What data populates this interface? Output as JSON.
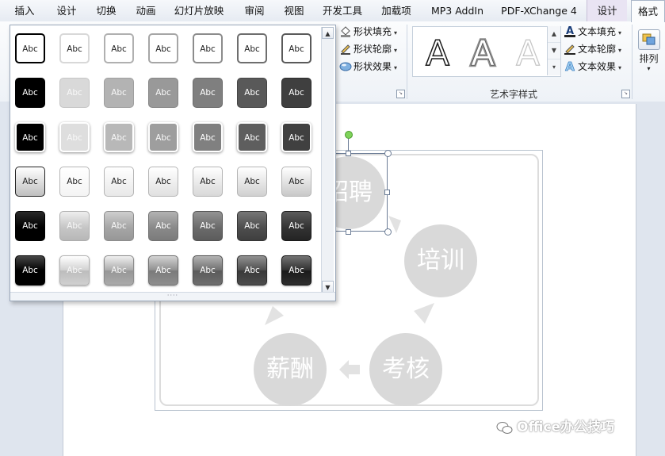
{
  "tabs": [
    {
      "label": "插入"
    },
    {
      "label": "设计"
    },
    {
      "label": "切换"
    },
    {
      "label": "动画"
    },
    {
      "label": "幻灯片放映"
    },
    {
      "label": "审阅"
    },
    {
      "label": "视图"
    },
    {
      "label": "开发工具"
    },
    {
      "label": "加载项"
    },
    {
      "label": "MP3 AddIn"
    },
    {
      "label": "PDF-XChange 4"
    },
    {
      "label": "设计"
    },
    {
      "label": "格式",
      "active": true
    }
  ],
  "ribbon": {
    "shape_fill": "形状填充",
    "shape_outline": "形状轮廓",
    "shape_effects": "形状效果",
    "text_fill": "文本填充",
    "text_outline": "文本轮廓",
    "text_effects": "文本效果",
    "wordart_group_label": "艺术字样式",
    "wordart_letter": "A",
    "arrange": "排列"
  },
  "style_gallery": {
    "swatch_text": "Abc",
    "rows": [
      {
        "kind": "outline",
        "shades": [
          "#000000",
          "#d8d8d8",
          "#b0b0b0",
          "#a6a6a6",
          "#8c8c8c",
          "#6e6e6e",
          "#5a5a5a"
        ]
      },
      {
        "kind": "fill",
        "shades": [
          "#000000",
          "#d9d9d9",
          "#b3b3b3",
          "#999999",
          "#7f7f7f",
          "#595959",
          "#3f3f3f"
        ]
      },
      {
        "kind": "fill-white-border",
        "shades": [
          "#000000",
          "#dedede",
          "#b8b8b8",
          "#9e9e9e",
          "#808080",
          "#5e5e5e",
          "#404040"
        ]
      },
      {
        "kind": "light-gradient",
        "shades": [
          "#bfbfbf",
          "#f4f4f4",
          "#e8e8e8",
          "#e0e0e0",
          "#d8d8d8",
          "#d0d0d0",
          "#c8c8c8"
        ]
      },
      {
        "kind": "gradient",
        "shades": [
          "#000000",
          "#c6c6c6",
          "#a6a6a6",
          "#8a8a8a",
          "#6b6b6b",
          "#4e4e4e",
          "#333333"
        ]
      },
      {
        "kind": "glossy",
        "shades": [
          "#000000",
          "#d0d0d0",
          "#aaaaaa",
          "#8e8e8e",
          "#6e6e6e",
          "#4c4c4c",
          "#2e2e2e"
        ]
      }
    ]
  },
  "smartart": {
    "nodes": [
      {
        "label": "招聘"
      },
      {
        "label": "培训"
      },
      {
        "label": "考核"
      },
      {
        "label": "薪酬"
      }
    ]
  },
  "watermark": "Office办公技巧",
  "colors": {
    "node_fill": "#d9d9d9",
    "arrow_fill": "#e2e2e2",
    "ribbon_bg": "#eef2f7",
    "context_tab": "#e9e4f3"
  }
}
